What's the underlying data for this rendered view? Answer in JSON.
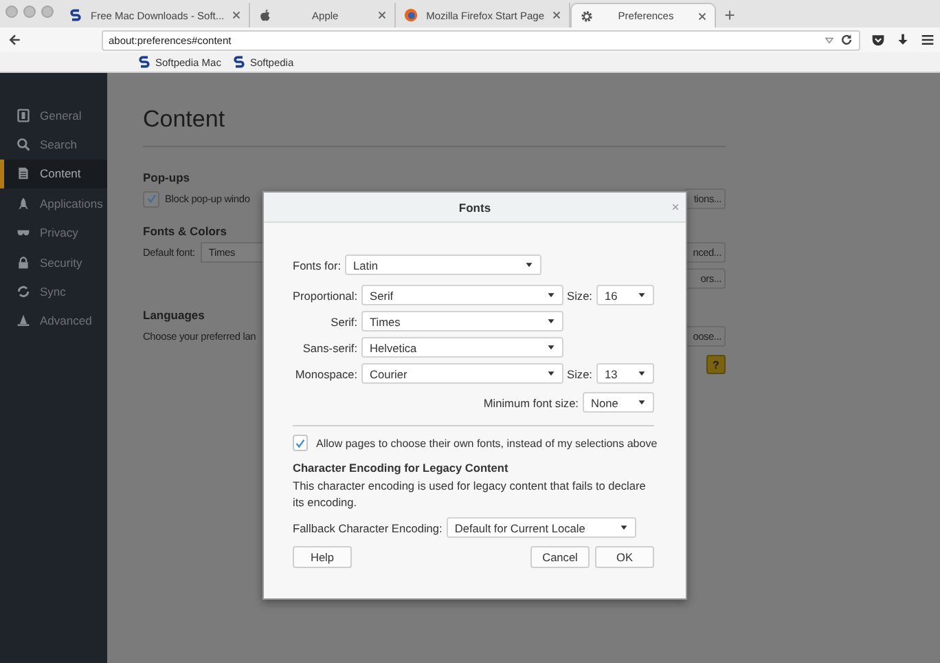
{
  "browser": {
    "tabs": [
      {
        "title": "Free Mac Downloads - Soft...",
        "kind": "letter",
        "selected": false
      },
      {
        "title": "Apple",
        "kind": "apple",
        "selected": false
      },
      {
        "title": "Mozilla Firefox Start Page",
        "kind": "globe",
        "selected": false
      },
      {
        "title": "Preferences",
        "kind": "gear",
        "selected": true
      }
    ],
    "url": "about:preferences#content",
    "bookmarks": [
      "Softpedia Mac",
      "Softpedia"
    ]
  },
  "sidebar": {
    "items": [
      {
        "label": "General",
        "kind": "general",
        "selected": false
      },
      {
        "label": "Search",
        "kind": "search",
        "selected": false
      },
      {
        "label": "Content",
        "kind": "content",
        "selected": true
      },
      {
        "label": "Applications",
        "kind": "applications",
        "selected": false
      },
      {
        "label": "Privacy",
        "kind": "privacy",
        "selected": false
      },
      {
        "label": "Security",
        "kind": "security",
        "selected": false
      },
      {
        "label": "Sync",
        "kind": "sync",
        "selected": false
      },
      {
        "label": "Advanced",
        "kind": "advanced",
        "selected": false
      }
    ]
  },
  "content": {
    "title": "Content",
    "popups": {
      "heading": "Pop-ups",
      "label": "Block pop-up windo",
      "checked": true,
      "button": "tions..."
    },
    "fonts_colors": {
      "heading": "Fonts & Colors",
      "default_font_label": "Default font:",
      "default_font": "Times",
      "buttons": [
        "nced...",
        "ors..."
      ]
    },
    "languages": {
      "heading": "Languages",
      "text": "Choose your preferred lan",
      "button": "oose...",
      "help": "?"
    }
  },
  "dialog": {
    "title": "Fonts",
    "fonts_for": {
      "label": "Fonts for:",
      "value": "Latin"
    },
    "rows": [
      {
        "label": "Proportional:",
        "value": "Serif",
        "size_label": "Size:",
        "size": "16"
      },
      {
        "label": "Serif:",
        "value": "Times"
      },
      {
        "label": "Sans-serif:",
        "value": "Helvetica"
      },
      {
        "label": "Monospace:",
        "value": "Courier",
        "size_label": "Size:",
        "size": "13"
      }
    ],
    "minimum": {
      "label": "Minimum font size:",
      "value": "None"
    },
    "allow": {
      "label": "Allow pages to choose their own fonts, instead of my selections above",
      "checked": true
    },
    "encoding": {
      "heading": "Character Encoding for Legacy Content",
      "description": "This character encoding is used for legacy content that fails to declare its encoding.",
      "fallback_label": "Fallback Character Encoding:",
      "fallback_value": "Default for Current Locale"
    },
    "buttons": {
      "help": "Help",
      "cancel": "Cancel",
      "ok": "OK"
    }
  }
}
